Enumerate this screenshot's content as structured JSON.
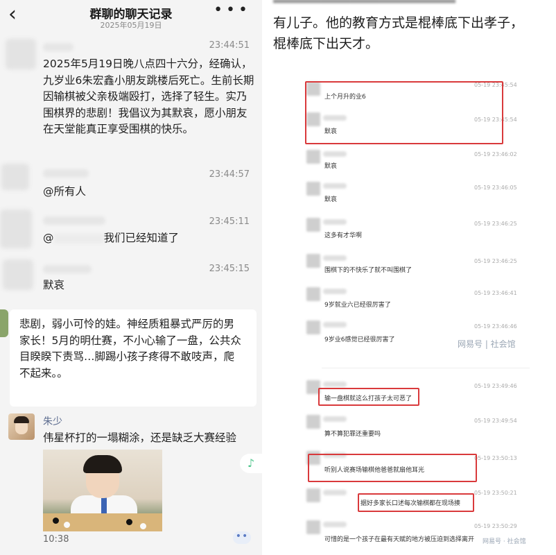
{
  "left": {
    "header": {
      "title": "群聊的聊天记录",
      "date": "2025年05月19日",
      "back_icon": "‹",
      "more_icon": "• • •"
    },
    "messages": [
      {
        "time": "23:44:51",
        "text": "2025年5月19日晚八点四十六分，经确认，九岁业6朱宏鑫小朋友跳楼后死亡。生前长期因输棋被父亲极端殴打，选择了轻生。实乃围棋界的悲剧！我倡议为其默哀，愿小朋友在天堂能真正享受围棋的快乐。"
      },
      {
        "time": "23:44:57",
        "text": "@所有人"
      },
      {
        "time": "23:45:11",
        "text_prefix": "@",
        "text_suffix": "我们已经知道了"
      },
      {
        "time": "23:45:15",
        "text": "默哀"
      }
    ],
    "bubble": {
      "text": "悲剧，弱小可怜的娃。神经质粗暴式严厉的男家长！5月的明仕赛，不小心输了一盘，公共众目睽睽下责骂…脚踢小孩子疼得不敢吱声，爬不起来。。"
    },
    "zhu_shao": {
      "name": "朱少",
      "text": "伟星杯打的一塌糊涂，还是缺乏大赛经验",
      "photo_time": "10:38"
    },
    "music_icon": "♪",
    "dots_icon": "••"
  },
  "right": {
    "top_line_1": "有儿子。他的教育方式是棍棒底下出孝子，",
    "top_line_2": "棍棒底下出天才。",
    "rows": [
      {
        "text": "上个月升的业6",
        "time": "05-19 23:45:54"
      },
      {
        "text": "默哀",
        "time": "05-19 23:45:54"
      },
      {
        "text": "默哀",
        "time": "05-19 23:46:02"
      },
      {
        "text": "默哀",
        "time": "05-19 23:46:05"
      },
      {
        "text": "这多有才华啊",
        "time": "05-19 23:46:25"
      },
      {
        "text": "围棋下的不快乐了就不叫围棋了",
        "time": "05-19 23:46:25"
      },
      {
        "text": "9岁就业六已经很厉害了",
        "time": "05-19 23:46:41"
      },
      {
        "text": "9岁业6感觉已经很厉害了",
        "time": "05-19 23:46:46"
      },
      {
        "text": "输一盘棋就这么打孩子太可恶了",
        "time": "05-19 23:49:46"
      },
      {
        "text": "算不算犯罪还重要吗",
        "time": "05-19 23:49:54"
      },
      {
        "text": "听别人说赛场输棋他爸爸就扇他耳光",
        "time": "05-19 23:50:13"
      },
      {
        "text": "据好多家长口述每次输棋都在现场揍",
        "time": "05-19 23:50:21"
      },
      {
        "text": "可惜的是一个孩子在最有天赋的地方被压迫到选择离开",
        "time": "05-19 23:50:29"
      }
    ],
    "watermark_1": "网易号 | 社会馆",
    "watermark_2": "网易号 · 社会馆"
  }
}
